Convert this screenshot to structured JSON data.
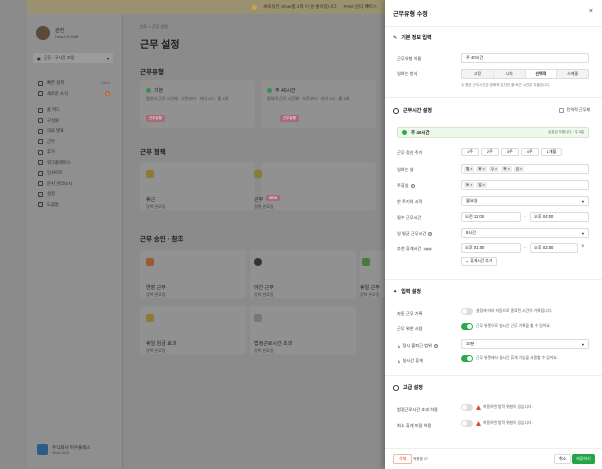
{
  "banner": {
    "text": "새로워진 Shoe를 2제 이 앞 좋아합니다.",
    "link": "PAID 원더 캐리스"
  },
  "profile": {
    "name": "관진",
    "role": "Head of Staff"
  },
  "workspace": {
    "label": "근무 · 구시간 조정"
  },
  "sidebar": {
    "items": [
      {
        "label": "빠른 검색",
        "shortcut": "Ctrl K"
      },
      {
        "label": "새로운 소식",
        "badge": "1"
      },
      {
        "label": "홈 피드"
      },
      {
        "label": "구성원"
      },
      {
        "label": "의료 발표"
      },
      {
        "label": "근무"
      },
      {
        "label": "휴가"
      },
      {
        "label": "워크플레이스"
      },
      {
        "label": "인사이트"
      },
      {
        "label": "문서 관리보시"
      },
      {
        "label": "설정"
      },
      {
        "label": "도움말"
      }
    ],
    "company": {
      "name": "주식회사 미우플렉스",
      "since": "Since 2001"
    }
  },
  "main": {
    "breadcrumb": "인도 > 근무 설정",
    "title": "근무 설정",
    "section_worktype": "근무유형",
    "card1": {
      "title": "기본",
      "sub": "평일의 근무 시간제 · 오전부터 · 저녁 1시 · 월 1회",
      "tag": "근무유형"
    },
    "card2": {
      "title": "주 40시간",
      "sub": "평일의 근무 시간제 · 오전부터 · 저녁 1시 · 월 1회",
      "tag": "근무유형"
    },
    "section_policy": "근무 정책",
    "policy1": {
      "title": "휴근",
      "sub": "정책 완료됨"
    },
    "policy2": {
      "title": "근무",
      "sub": "정책 완료됨",
      "tag": "NEW"
    },
    "section_approval": "근무 승인 · 참조",
    "approval": [
      {
        "title": "연장 근무",
        "sub": "정책 완료됨"
      },
      {
        "title": "야간 근무",
        "sub": "정책 완료됨"
      },
      {
        "title": "휴일 근무",
        "sub": "정책 완료됨"
      },
      {
        "title": "휴일 임금 효과",
        "sub": "정책 완료됨"
      },
      {
        "title": "법정근로시간 초과",
        "sub": "정책 완료됨"
      }
    ]
  },
  "panel": {
    "title": "근무유형 수정",
    "basic": {
      "title": "기본 정보 입력",
      "name_label": "근무유형 이름",
      "name_value": "주 40시간",
      "method_label": "일하는 방식",
      "methods": [
        "고정",
        "시차",
        "선택적",
        "스케줄"
      ],
      "method_active": 2,
      "method_note": "주 평균 근무시간은 정해져 있지만 출·퇴근 시간은 자율입니다."
    },
    "hours": {
      "title": "근무시간 설정",
      "flex_label": "탄력적 근무제",
      "banner_title": "주 40시간",
      "banner_note": "유효성 오합니다 · 주 5일",
      "period_label": "근무 정산 주기",
      "periods": [
        "1주",
        "2주",
        "3주",
        "4주",
        "1개월"
      ],
      "days_label": "일하는 날",
      "days": [
        "월",
        "화",
        "수",
        "목",
        "금"
      ],
      "holiday_label": "주휴일",
      "holidays": [
        "토",
        "일"
      ],
      "weekstart_label": "한 주기의 시작",
      "weekstart_value": "월요일",
      "core_label": "필수 근무시간",
      "core_start": "오전 11:00",
      "core_end": "오후 04:00",
      "daily_label": "일 평균 근무시간",
      "daily_value": "8시간",
      "break_label": "추천 휴게시간",
      "break_tag": "NEW",
      "break_start": "오후 01:00",
      "break_end": "오후 02:00",
      "add_break": "휴게시간 추가"
    },
    "record": {
      "title": "입력 설정",
      "auto_label": "자동 근무 기록",
      "auto_desc": "설정에 따라 자동으로 종료된 시간이 기록됩니다.",
      "late_label": "근무 위한 시용",
      "late_desc": "근무 위젯으로 실시간 근무 기록을 할 수 있어요.",
      "round_label": "정시 출퇴근 범위",
      "round_value": "10분",
      "realtime_label": "실시간 휴게",
      "realtime_desc": "근무 위젯에서 실시간 휴게 기능을 사용할 수 있어요."
    },
    "advanced": {
      "title": "고급 설정",
      "over_label": "법정근로시간 초과 허용",
      "over_desc": "허용하면 법적 위험이 있습니다.",
      "min_break_label": "최소 휴게 미달 허용",
      "min_break_desc": "허용하면 법적 위험이 있습니다."
    },
    "footer": {
      "delete": "삭제",
      "used": "적용중 27",
      "cancel": "취소",
      "save": "저장하기"
    }
  }
}
